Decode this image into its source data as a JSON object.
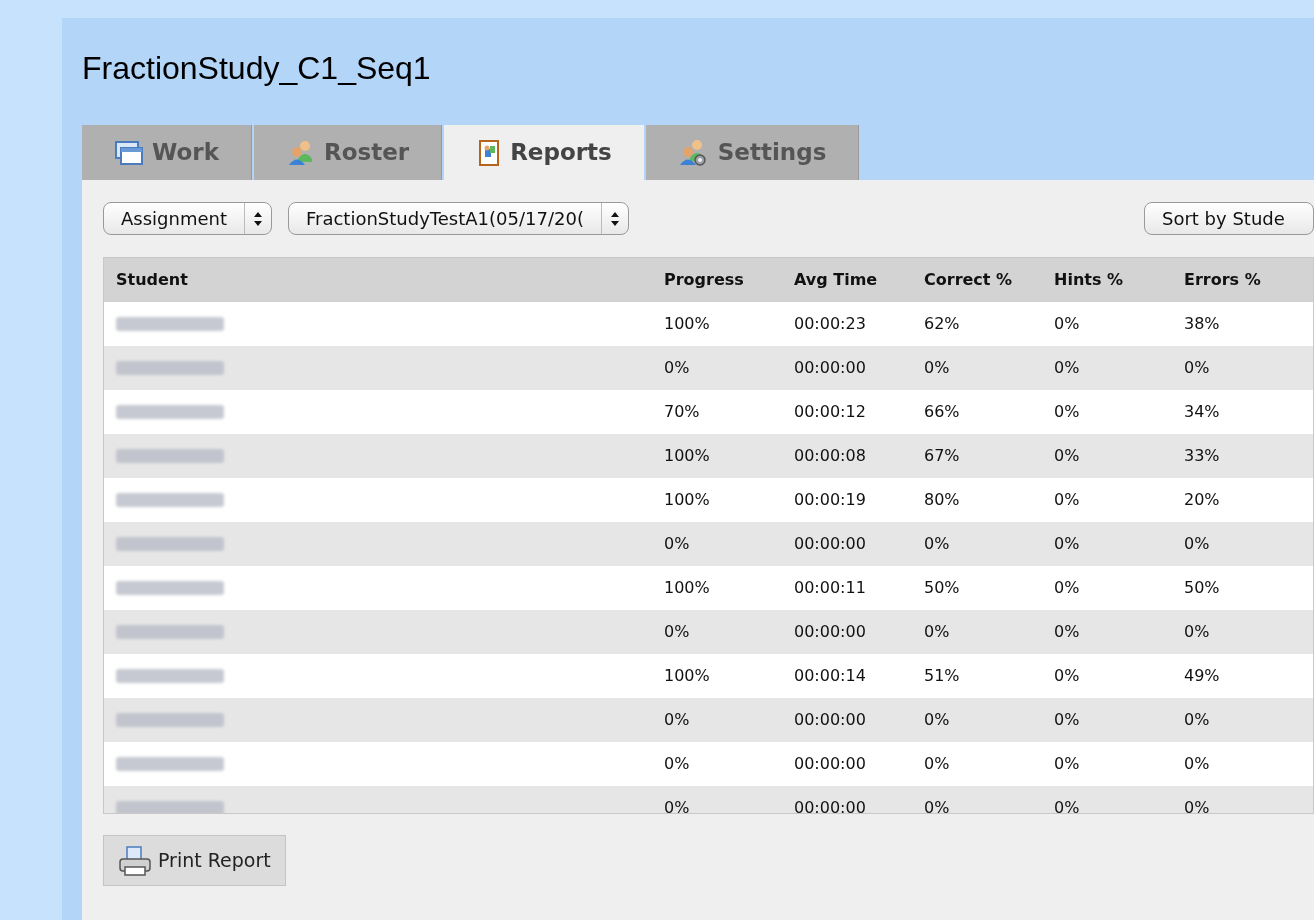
{
  "title": "FractionStudy_C1_Seq1",
  "tabs": [
    {
      "label": "Work",
      "selected": false
    },
    {
      "label": "Roster",
      "selected": false
    },
    {
      "label": "Reports",
      "selected": true
    },
    {
      "label": "Settings",
      "selected": false
    }
  ],
  "filters": [
    {
      "value": "Assignment"
    },
    {
      "value": "FractionStudyTestA1(05/17/20("
    }
  ],
  "sort": {
    "value": "Sort by Stude"
  },
  "table": {
    "student_column": "Student",
    "columns": [
      "Progress",
      "Avg Time",
      "Correct %",
      "Hints %",
      "Errors %"
    ],
    "rows": [
      {
        "student_blurred": true,
        "cells": [
          "100%",
          "00:00:23",
          "62%",
          "0%",
          "38%"
        ]
      },
      {
        "student_blurred": true,
        "cells": [
          "0%",
          "00:00:00",
          "0%",
          "0%",
          "0%"
        ]
      },
      {
        "student_blurred": true,
        "cells": [
          "70%",
          "00:00:12",
          "66%",
          "0%",
          "34%"
        ]
      },
      {
        "student_blurred": true,
        "cells": [
          "100%",
          "00:00:08",
          "67%",
          "0%",
          "33%"
        ]
      },
      {
        "student_blurred": true,
        "cells": [
          "100%",
          "00:00:19",
          "80%",
          "0%",
          "20%"
        ]
      },
      {
        "student_blurred": true,
        "cells": [
          "0%",
          "00:00:00",
          "0%",
          "0%",
          "0%"
        ]
      },
      {
        "student_blurred": true,
        "cells": [
          "100%",
          "00:00:11",
          "50%",
          "0%",
          "50%"
        ]
      },
      {
        "student_blurred": true,
        "cells": [
          "0%",
          "00:00:00",
          "0%",
          "0%",
          "0%"
        ]
      },
      {
        "student_blurred": true,
        "cells": [
          "100%",
          "00:00:14",
          "51%",
          "0%",
          "49%"
        ]
      },
      {
        "student_blurred": true,
        "cells": [
          "0%",
          "00:00:00",
          "0%",
          "0%",
          "0%"
        ]
      },
      {
        "student_blurred": true,
        "cells": [
          "0%",
          "00:00:00",
          "0%",
          "0%",
          "0%"
        ]
      },
      {
        "student_blurred": true,
        "cells": [
          "0%",
          "00:00:00",
          "0%",
          "0%",
          "0%"
        ]
      }
    ]
  },
  "print_button": "Print Report"
}
